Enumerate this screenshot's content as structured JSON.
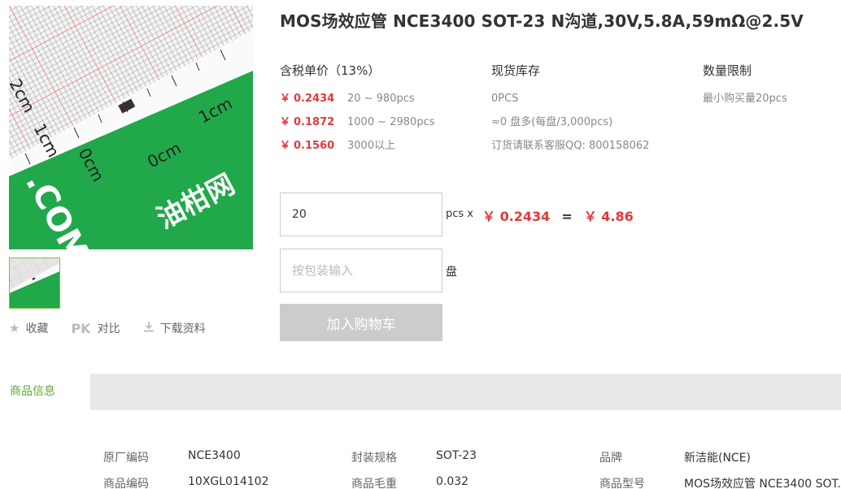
{
  "title": "MOS场效应管 NCE3400 SOT-23 N沟道,30V,5.8A,59mΩ@2.5V",
  "image": {
    "ruler_labels": [
      "1cm",
      "0cm",
      "0cm",
      "1cm",
      "2cm"
    ],
    "logo_text": ".COM",
    "brand_text": "油柑网",
    "colors": {
      "green": "#21a84a",
      "grid": "#333333",
      "accent_line": "#f05050"
    }
  },
  "actions": {
    "favorite_label": "收藏",
    "compare_prefix": "PK",
    "compare_label": "对比",
    "download_label": "下载资料"
  },
  "price_col": {
    "header": "含税单价（13%）",
    "currency": "￥",
    "tiers": [
      {
        "price": "0.2434",
        "range": "20 ~ 980pcs"
      },
      {
        "price": "0.1872",
        "range": "1000 ~ 2980pcs"
      },
      {
        "price": "0.1560",
        "range": "3000以上"
      }
    ]
  },
  "stock_col": {
    "header": "现货库存",
    "lines": [
      "0PCS",
      "≈0 盘多(每盘/3,000pcs)",
      "订货请联系客服QQ: 800158062"
    ]
  },
  "limit_col": {
    "header": "数量限制",
    "lines": [
      "最小购买量20pcs"
    ]
  },
  "order": {
    "qty_value": "20",
    "unit_label": "pcs x",
    "unit_price": "￥ 0.2434",
    "equals": "=",
    "total": "￥ 4.86",
    "pkg_placeholder": "按包装输入",
    "pkg_unit": "盘",
    "cart_label": "加入购物车"
  },
  "tabs": {
    "active": "商品信息"
  },
  "info": [
    {
      "key": "原厂编码",
      "value": "NCE3400"
    },
    {
      "key": "封装规格",
      "value": "SOT-23"
    },
    {
      "key": "品牌",
      "value": "新洁能(NCE)"
    },
    {
      "key": "商品编码",
      "value": "10XGL014102"
    },
    {
      "key": "商品毛重",
      "value": "0.032"
    },
    {
      "key": "商品型号",
      "value": "MOS场效应管 NCE3400 SOT..."
    }
  ]
}
